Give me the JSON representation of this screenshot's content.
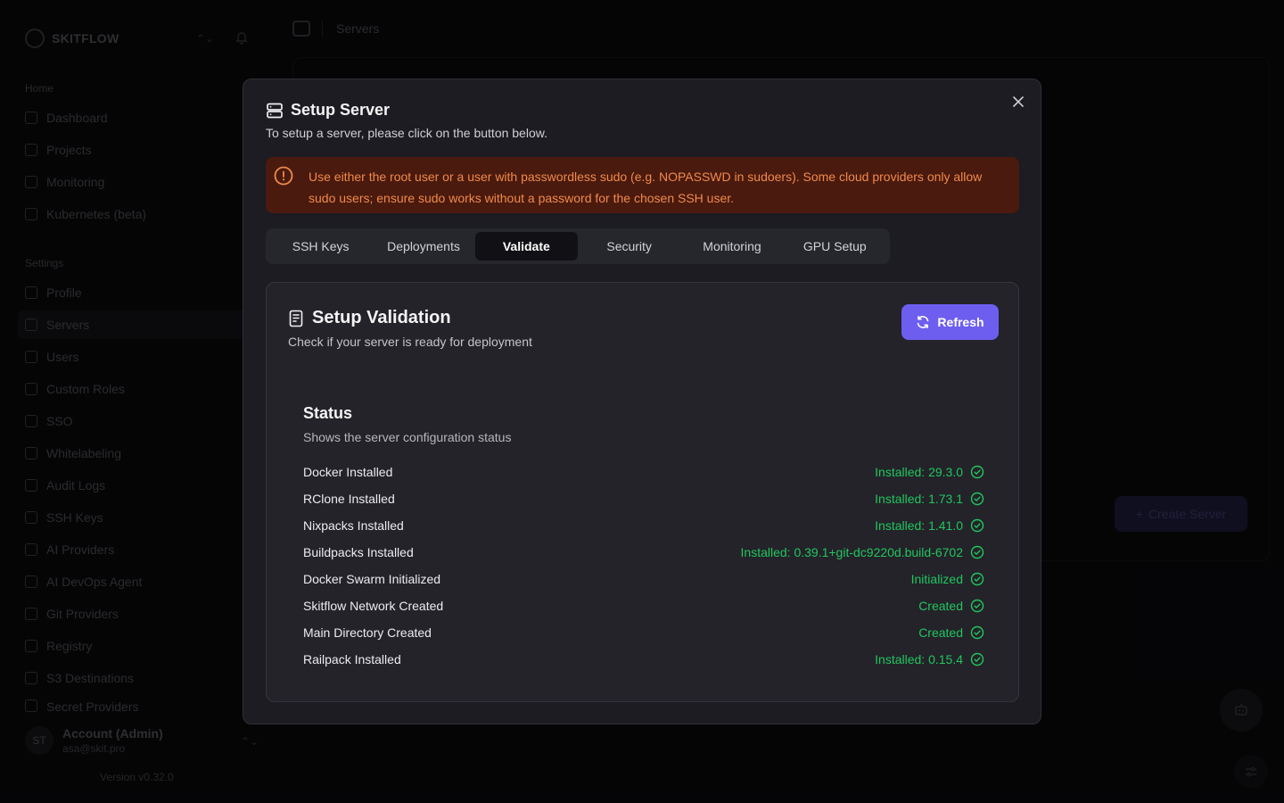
{
  "brand": {
    "name": "SKITFLOW"
  },
  "sidebar": {
    "home_label": "Home",
    "home_items": [
      {
        "label": "Dashboard",
        "icon": "home-icon"
      },
      {
        "label": "Projects",
        "icon": "folder-icon"
      },
      {
        "label": "Monitoring",
        "icon": "chart-icon"
      },
      {
        "label": "Kubernetes (beta)",
        "icon": "cube-icon"
      }
    ],
    "settings_label": "Settings",
    "settings_items": [
      {
        "label": "Profile",
        "icon": "user-icon"
      },
      {
        "label": "Servers",
        "icon": "server-icon"
      },
      {
        "label": "Users",
        "icon": "users-icon"
      },
      {
        "label": "Custom Roles",
        "icon": "roles-icon"
      },
      {
        "label": "SSO",
        "icon": "shield-icon"
      },
      {
        "label": "Whitelabeling",
        "icon": "palette-icon"
      },
      {
        "label": "Audit Logs",
        "icon": "activity-icon"
      },
      {
        "label": "SSH Keys",
        "icon": "key-icon"
      },
      {
        "label": "AI Providers",
        "icon": "sparkle-icon"
      },
      {
        "label": "AI DevOps Agent",
        "icon": "bot-icon"
      },
      {
        "label": "Git Providers",
        "icon": "git-icon"
      },
      {
        "label": "Registry",
        "icon": "package-icon"
      },
      {
        "label": "S3 Destinations",
        "icon": "database-icon"
      },
      {
        "label": "Secret Providers",
        "icon": "lock-icon"
      }
    ],
    "account": {
      "initials": "ST",
      "name": "Account (Admin)",
      "email": "asa@skit.pro"
    },
    "version": "Version v0.32.0"
  },
  "header": {
    "breadcrumb": "Servers"
  },
  "background": {
    "create_server_label": "Create Server"
  },
  "modal": {
    "title": "Setup Server",
    "subtitle": "To setup a server, please click on the button below.",
    "alert": "Use either the root user or a user with passwordless sudo (e.g. NOPASSWD in sudoers). Some cloud providers only allow sudo users; ensure sudo works without a password for the chosen SSH user.",
    "tabs": [
      "SSH Keys",
      "Deployments",
      "Validate",
      "Security",
      "Monitoring",
      "GPU Setup"
    ],
    "active_tab": "Validate",
    "validation": {
      "title": "Setup Validation",
      "subtitle": "Check if your server is ready for deployment",
      "refresh_label": "Refresh",
      "status_title": "Status",
      "status_subtitle": "Shows the server configuration status",
      "rows": [
        {
          "label": "Docker Installed",
          "value": "Installed: 29.3.0"
        },
        {
          "label": "RClone Installed",
          "value": "Installed: 1.73.1"
        },
        {
          "label": "Nixpacks Installed",
          "value": "Installed: 1.41.0"
        },
        {
          "label": "Buildpacks Installed",
          "value": "Installed: 0.39.1+git-dc9220d.build-6702"
        },
        {
          "label": "Docker Swarm Initialized",
          "value": "Initialized"
        },
        {
          "label": "Skitflow Network Created",
          "value": "Created"
        },
        {
          "label": "Main Directory Created",
          "value": "Created"
        },
        {
          "label": "Railpack Installed",
          "value": "Installed: 0.15.4"
        }
      ]
    }
  },
  "colors": {
    "accent": "#6d5ef0",
    "success": "#22c55e",
    "warning_text": "#f08a4a",
    "warning_bg": "#4a1a0e"
  }
}
